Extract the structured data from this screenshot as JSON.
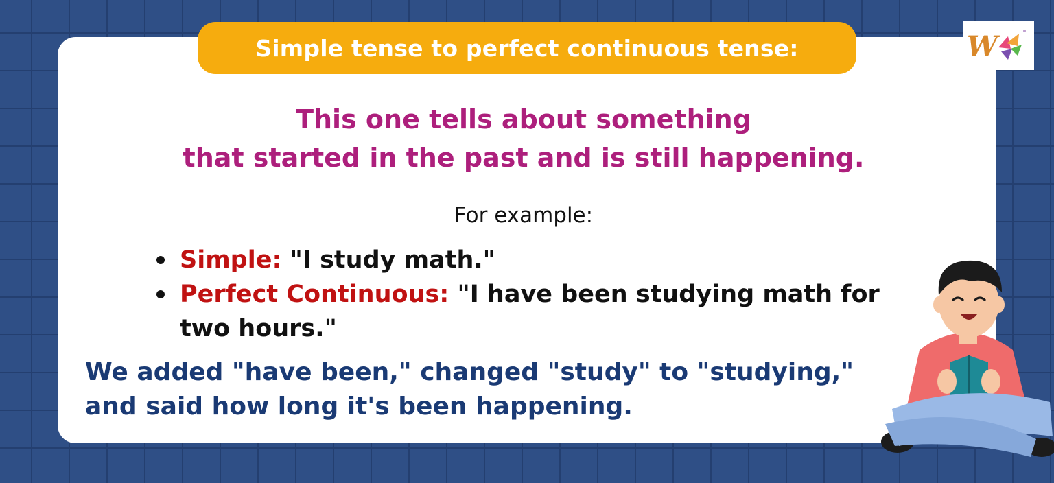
{
  "title": "Simple tense to perfect continuous tense:",
  "headline": {
    "line1": "This one tells about something",
    "line2": "that started in the past and is still happening."
  },
  "example_label": "For example:",
  "examples": [
    {
      "label": "Simple:",
      "text": "\"I study math.\""
    },
    {
      "label": "Perfect Continuous:",
      "text": "\"I have been studying math for two hours.\""
    }
  ],
  "summary": {
    "line1": "We added \"have been,\" changed \"study\" to \"studying,\"",
    "line2": "and said how long it's been happening."
  },
  "colors": {
    "background": "#2f4f86",
    "title_pill": "#f6ac0e",
    "headline": "#ad1f7c",
    "example_label": "#c01212",
    "summary": "#1a3a74"
  },
  "icons": {
    "logo": "brand-logo-icon",
    "illustration": "boy-reading-book-illustration"
  }
}
